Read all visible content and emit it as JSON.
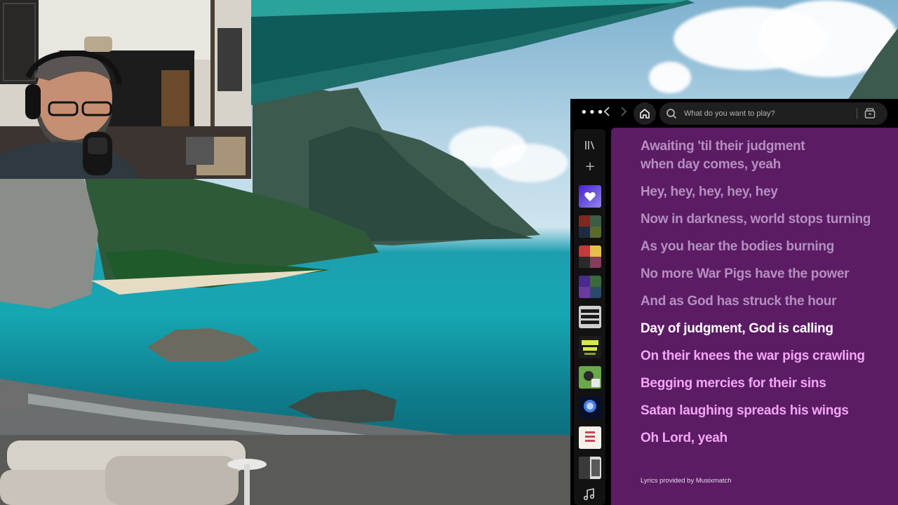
{
  "topbar": {
    "more_icon": "more-horizontal-icon",
    "back_icon": "chevron-left-icon",
    "forward_icon": "chevron-right-icon",
    "home_icon": "home-icon",
    "search_icon": "search-icon",
    "search_placeholder": "What do you want to play?",
    "browse_icon": "browse-icon"
  },
  "sidebar": {
    "library_icon": "library-icon",
    "create_icon": "plus-icon",
    "playlists": [
      {
        "name": "liked-songs",
        "color": "#6b45d8"
      },
      {
        "name": "playlist-2",
        "color": "#2e4a34"
      },
      {
        "name": "playlist-3",
        "color": "#b0303a"
      },
      {
        "name": "playlist-4",
        "color": "#5a2a7a"
      },
      {
        "name": "playlist-5",
        "color": "#d8d8d8"
      },
      {
        "name": "playlist-6",
        "color": "#1d1d1d"
      },
      {
        "name": "playlist-7",
        "color": "#3d8a3a"
      },
      {
        "name": "playlist-8",
        "color": "#0e1a3a"
      },
      {
        "name": "playlist-9",
        "color": "#f2efe8"
      },
      {
        "name": "playlist-10",
        "color": "#2a2a2a"
      }
    ],
    "music_icon": "music-note-icon"
  },
  "lyrics": {
    "lines": [
      {
        "text": "Awaiting 'til their judgment",
        "state": "past"
      },
      {
        "text": "when day comes, yeah",
        "state": "past"
      },
      {
        "text": "Hey, hey, hey, hey, hey",
        "state": "past"
      },
      {
        "text": "Now in darkness, world stops turning",
        "state": "past"
      },
      {
        "text": "As you hear the bodies burning",
        "state": "past"
      },
      {
        "text": "No more War Pigs have the power",
        "state": "past"
      },
      {
        "text": "And as God has struck the hour",
        "state": "past"
      },
      {
        "text": "Day of judgment, God is calling",
        "state": "current"
      },
      {
        "text": "On their knees the war pigs crawling",
        "state": "future"
      },
      {
        "text": "Begging mercies for their sins",
        "state": "future"
      },
      {
        "text": "Satan laughing spreads his wings",
        "state": "future"
      },
      {
        "text": "Oh Lord, yeah",
        "state": "future"
      }
    ],
    "provider": "Lyrics provided by Musixmatch",
    "background_color": "#5b1c64"
  }
}
